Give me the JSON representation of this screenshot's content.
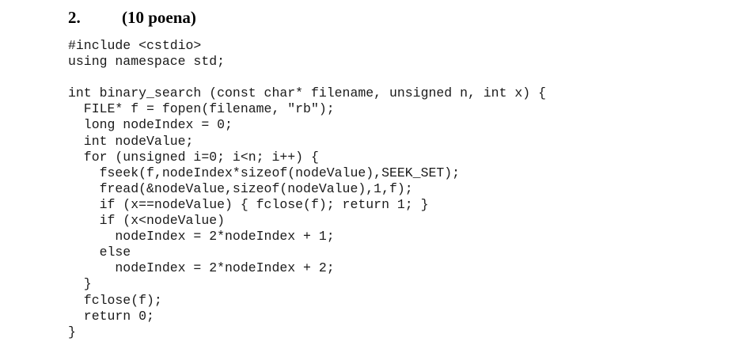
{
  "heading": {
    "number": "2.",
    "points": "(10 poena)"
  },
  "code": {
    "lines": [
      "#include <cstdio>",
      "using namespace std;",
      "",
      "int binary_search (const char* filename, unsigned n, int x) {",
      "  FILE* f = fopen(filename, \"rb\");",
      "  long nodeIndex = 0;",
      "  int nodeValue;",
      "  for (unsigned i=0; i<n; i++) {",
      "    fseek(f,nodeIndex*sizeof(nodeValue),SEEK_SET);",
      "    fread(&nodeValue,sizeof(nodeValue),1,f);",
      "    if (x==nodeValue) { fclose(f); return 1; }",
      "    if (x<nodeValue)",
      "      nodeIndex = 2*nodeIndex + 1;",
      "    else",
      "      nodeIndex = 2*nodeIndex + 2;",
      "  }",
      "  fclose(f);",
      "  return 0;",
      "}"
    ]
  }
}
